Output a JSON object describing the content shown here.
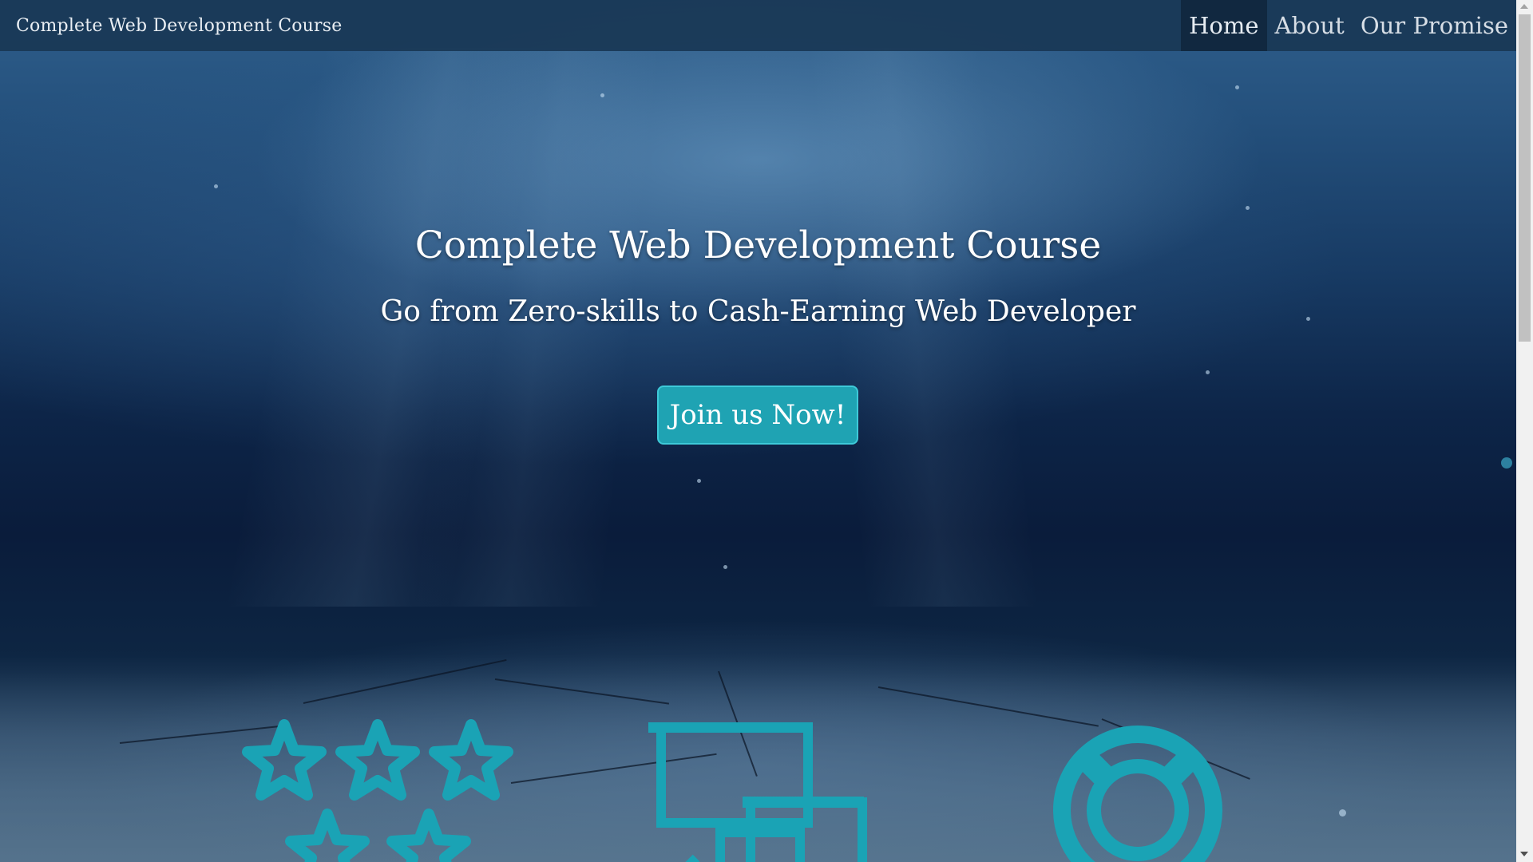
{
  "navbar": {
    "brand": "Complete Web Development Course",
    "links": [
      {
        "label": "Home",
        "active": true
      },
      {
        "label": "About",
        "active": false
      },
      {
        "label": "Our Promise",
        "active": false
      }
    ]
  },
  "hero": {
    "title": "Complete Web Development Course",
    "subtitle": "Go from Zero-skills to Cash-Earning Web Developer",
    "cta_label": "Join us Now!"
  },
  "features": {
    "icons": [
      "stars-icon",
      "windows-icon",
      "life-ring-icon"
    ]
  },
  "colors": {
    "accent": "#1fa3b3",
    "navbar": "#19375a",
    "nav_active": "#112840",
    "icon": "#1aa3b5"
  }
}
